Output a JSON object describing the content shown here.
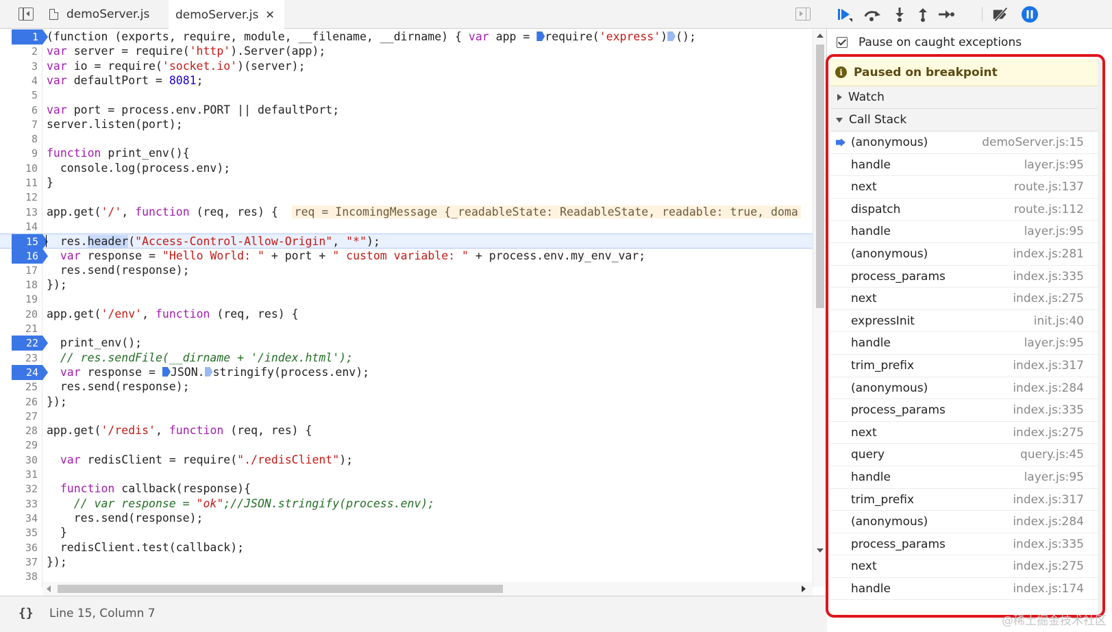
{
  "tabs": [
    {
      "label": "demoServer.js",
      "active": false
    },
    {
      "label": "demoServer.js",
      "active": true,
      "close": "✕"
    }
  ],
  "code_lines": [
    {
      "n": "1",
      "bp": true
    },
    {
      "n": "2"
    },
    {
      "n": "3"
    },
    {
      "n": "4"
    },
    {
      "n": "5"
    },
    {
      "n": "6"
    },
    {
      "n": "7"
    },
    {
      "n": "8"
    },
    {
      "n": "9"
    },
    {
      "n": "10"
    },
    {
      "n": "11"
    },
    {
      "n": "12"
    },
    {
      "n": "13"
    },
    {
      "n": "14"
    },
    {
      "n": "15",
      "bp": true
    },
    {
      "n": "16",
      "bp": true
    },
    {
      "n": "17"
    },
    {
      "n": "18"
    },
    {
      "n": "19"
    },
    {
      "n": "20"
    },
    {
      "n": "21"
    },
    {
      "n": "22",
      "bp": true
    },
    {
      "n": "23"
    },
    {
      "n": "24",
      "bp": true
    },
    {
      "n": "25"
    },
    {
      "n": "26"
    },
    {
      "n": "27"
    },
    {
      "n": "28"
    },
    {
      "n": "29"
    },
    {
      "n": "30"
    },
    {
      "n": "31"
    },
    {
      "n": "32"
    },
    {
      "n": "33"
    },
    {
      "n": "34"
    },
    {
      "n": "35"
    },
    {
      "n": "36"
    },
    {
      "n": "37"
    },
    {
      "n": "38"
    }
  ],
  "code": {
    "l1a": "(function (exports, require, module, __filename, __dirname) { ",
    "l1b": "var",
    "l1c": " app = ",
    "l1d": "require(",
    "l1e": "'express'",
    "l1f": ")",
    "l1g": "();",
    "l2a": "var",
    "l2b": " server = require(",
    "l2c": "'http'",
    "l2d": ").Server(app);",
    "l3a": "var",
    "l3b": " io = require(",
    "l3c": "'socket.io'",
    "l3d": ")(server);",
    "l4a": "var",
    "l4b": " defaultPort = ",
    "l4c": "8081",
    "l4d": ";",
    "l6a": "var",
    "l6b": " port = process.env.PORT || defaultPort;",
    "l7": "server.listen(port);",
    "l9a": "function",
    "l9b": " print_env(){",
    "l10": "  console.log(process.env);",
    "l11": "}",
    "l13a": "app.get(",
    "l13b": "'/'",
    "l13c": ", ",
    "l13d": "function",
    "l13e": " (req, res) {  ",
    "l13f": "req = IncomingMessage {_readableState: ReadableState, readable: true, doma",
    "l15a": "  res.",
    "l15b": "header",
    "l15c": "(",
    "l15d": "\"Access-Control-Allow-Origin\"",
    "l15e": ", ",
    "l15f": "\"*\"",
    "l15g": ");",
    "l16a": "  ",
    "l16b": "var",
    "l16c": " response = ",
    "l16d": "\"Hello World: \"",
    "l16e": " + port + ",
    "l16f": "\" custom variable: \"",
    "l16g": " + process.env.my_env_var;",
    "l17": "  res.send(response);",
    "l18": "});",
    "l20a": "app.get(",
    "l20b": "'/env'",
    "l20c": ", ",
    "l20d": "function",
    "l20e": " (req, res) {",
    "l22": "  print_env();",
    "l23": "  // res.sendFile(__dirname + '/index.html');",
    "l24a": "  ",
    "l24b": "var",
    "l24c": " response = ",
    "l24d": "JSON.",
    "l24e": "stringify(process.env);",
    "l25": "  res.send(response);",
    "l26": "});",
    "l28a": "app.get(",
    "l28b": "'/redis'",
    "l28c": ", ",
    "l28d": "function",
    "l28e": " (req, res) {",
    "l30a": "  ",
    "l30b": "var",
    "l30c": " redisClient = require(",
    "l30d": "\"./redisClient\"",
    "l30e": ");",
    "l32a": "  ",
    "l32b": "function",
    "l32c": " callback(response){",
    "l33a": "    // var response = ",
    "l33b": "\"ok\"",
    "l33c": ";//JSON.stringify(process.env);",
    "l34": "    res.send(response);",
    "l35": "  }",
    "l36": "  redisClient.test(callback);",
    "l37": "});"
  },
  "status_bar": {
    "pretty_print_icon": "{}",
    "position": "Line 15, Column 7"
  },
  "debug_toolbar": {
    "buttons": [
      "resume-icon",
      "step-over-icon",
      "step-into-icon",
      "step-out-icon",
      "step-icon",
      "deactivate-breakpoints-icon",
      "pause-on-exceptions-icon"
    ],
    "accent": "#1a73e8"
  },
  "pause_on_caught": {
    "label": "Pause on caught exceptions",
    "checked": true
  },
  "paused_banner": {
    "icon": "i",
    "text": "Paused on breakpoint"
  },
  "watch": {
    "label": "Watch"
  },
  "call_stack": {
    "label": "Call Stack",
    "frames": [
      {
        "name": "(anonymous)",
        "loc": "demoServer.js:15",
        "selected": true
      },
      {
        "name": "handle",
        "loc": "layer.js:95"
      },
      {
        "name": "next",
        "loc": "route.js:137"
      },
      {
        "name": "dispatch",
        "loc": "route.js:112"
      },
      {
        "name": "handle",
        "loc": "layer.js:95"
      },
      {
        "name": "(anonymous)",
        "loc": "index.js:281"
      },
      {
        "name": "process_params",
        "loc": "index.js:335"
      },
      {
        "name": "next",
        "loc": "index.js:275"
      },
      {
        "name": "expressInit",
        "loc": "init.js:40"
      },
      {
        "name": "handle",
        "loc": "layer.js:95"
      },
      {
        "name": "trim_prefix",
        "loc": "index.js:317"
      },
      {
        "name": "(anonymous)",
        "loc": "index.js:284"
      },
      {
        "name": "process_params",
        "loc": "index.js:335"
      },
      {
        "name": "next",
        "loc": "index.js:275"
      },
      {
        "name": "query",
        "loc": "query.js:45"
      },
      {
        "name": "handle",
        "loc": "layer.js:95"
      },
      {
        "name": "trim_prefix",
        "loc": "index.js:317"
      },
      {
        "name": "(anonymous)",
        "loc": "index.js:284"
      },
      {
        "name": "process_params",
        "loc": "index.js:335"
      },
      {
        "name": "next",
        "loc": "index.js:275"
      },
      {
        "name": "handle",
        "loc": "index.js:174"
      }
    ]
  },
  "highlight_color": "#e0151b",
  "watermark": "@稀土掘金技术社区"
}
